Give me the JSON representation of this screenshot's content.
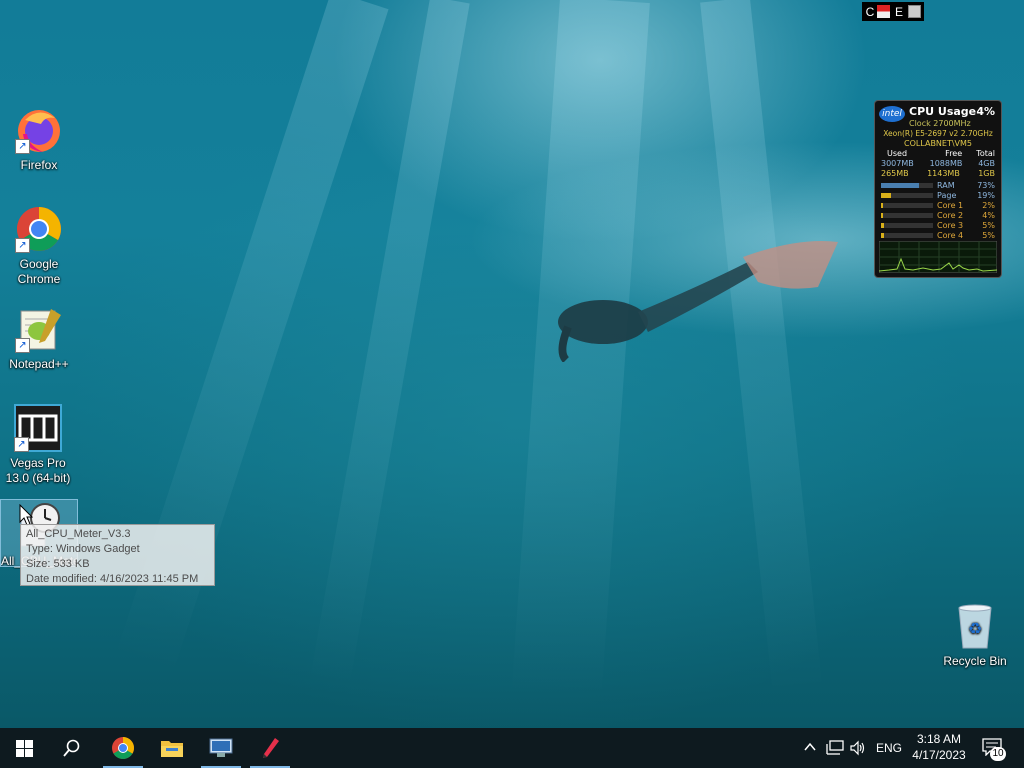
{
  "desktop": {
    "icons": [
      {
        "label": "Firefox"
      },
      {
        "label": "Google Chrome"
      },
      {
        "label": "Notepad++"
      },
      {
        "label": "Vegas Pro 13.0 (64-bit)"
      },
      {
        "label": "All_CPU_Meter_V3.3"
      },
      {
        "label": "Recycle Bin"
      }
    ],
    "tooltip": {
      "name": "All_CPU_Meter_V3.3",
      "type": "Type: Windows Gadget",
      "size": "Size: 533 KB",
      "modified": "Date modified: 4/16/2023 11:45 PM"
    },
    "top_widget": {
      "c": "C",
      "e": "E"
    }
  },
  "gadget": {
    "brand": "intel",
    "title": "CPU Usage",
    "cpu_percent": "4%",
    "clock": "Clock 2700MHz",
    "cpu_name": "Xeon(R) E5-2697 v2 2.70GHz",
    "host": "COLLABNET\\VM5",
    "headers": [
      "Used",
      "Free",
      "Total"
    ],
    "mem_rows": [
      {
        "used": "3007MB",
        "free": "1088MB",
        "total": "4GB"
      },
      {
        "used": "265MB",
        "free": "1143MB",
        "total": "1GB"
      }
    ],
    "meters": [
      {
        "label": "RAM",
        "value": "73%",
        "fraction": 0.73,
        "color": "#4a7fb0"
      },
      {
        "label": "Page",
        "value": "19%",
        "fraction": 0.19,
        "color": "#d9b01a"
      },
      {
        "label": "Core 1",
        "value": "2%",
        "fraction": 0.02,
        "color": "#d9b01a"
      },
      {
        "label": "Core 2",
        "value": "4%",
        "fraction": 0.04,
        "color": "#d9b01a"
      },
      {
        "label": "Core 3",
        "value": "5%",
        "fraction": 0.05,
        "color": "#d9b01a"
      },
      {
        "label": "Core 4",
        "value": "5%",
        "fraction": 0.05,
        "color": "#d9b01a"
      }
    ]
  },
  "taskbar": {
    "apps": [
      "start-icon",
      "search-icon",
      "chrome-icon",
      "file-explorer-icon",
      "remote-desktop-icon",
      "pen-icon"
    ],
    "language": "ENG",
    "time": "3:18 AM",
    "date": "4/17/2023",
    "notification_count": "10"
  }
}
